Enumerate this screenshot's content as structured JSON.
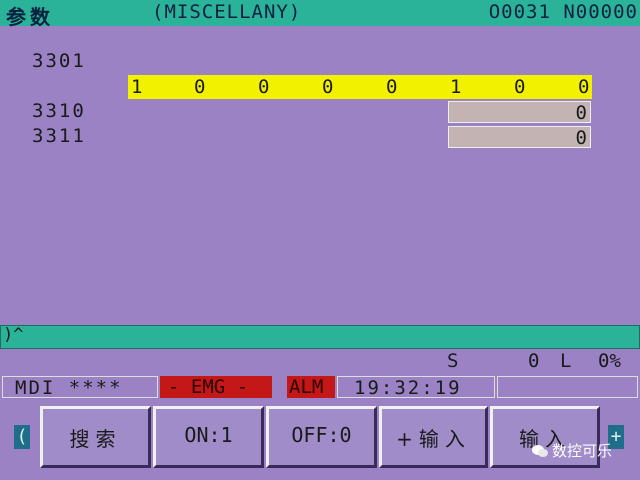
{
  "header": {
    "title": "参数",
    "screen": "(MISCELLANY)",
    "program": "O0031 N00000"
  },
  "params": {
    "p3301": {
      "number": "3301",
      "bits": [
        "1",
        "0",
        "0",
        "0",
        "0",
        "1",
        "0",
        "0"
      ]
    },
    "p3310": {
      "number": "3310",
      "value": "0"
    },
    "p3311": {
      "number": "3311",
      "value": "0"
    }
  },
  "command_line": {
    "text": ")^"
  },
  "spindle": {
    "s_label": "S",
    "s_value": "0",
    "l_label": "L",
    "load": "0%"
  },
  "status": {
    "mode": "MDI ****",
    "emg": "- EMG -",
    "alm": "ALM",
    "time": "19:32:19"
  },
  "softkeys": {
    "left_arrow": "(",
    "search": "搜索",
    "on1": "ON:1",
    "off0": "OFF:0",
    "plus_input": "+输入",
    "input": "输入",
    "right_arrow": "+"
  },
  "watermark": {
    "text": "数控可乐"
  },
  "colors": {
    "background": "#9a82c4",
    "title_bar": "#2bb39a",
    "bit_highlight": "#f2f200",
    "alarm": "#c41818"
  }
}
